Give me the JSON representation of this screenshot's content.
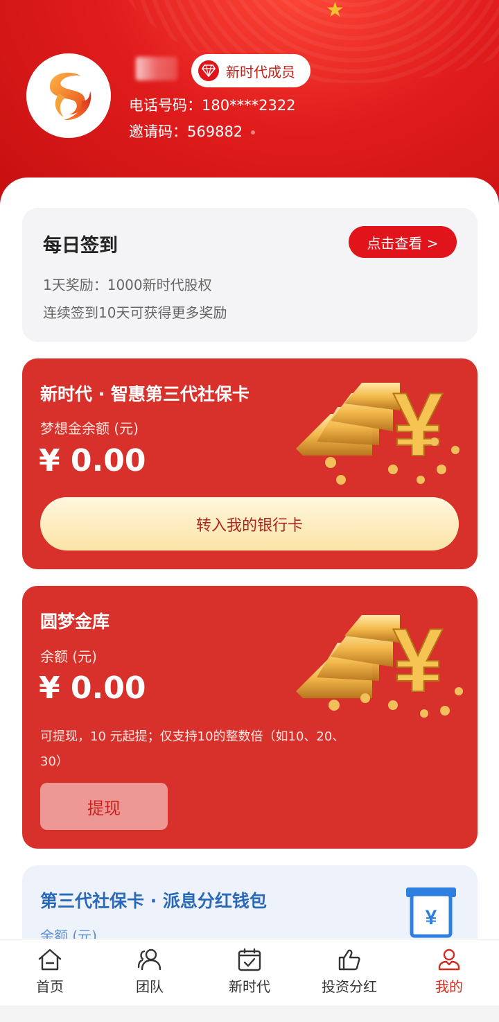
{
  "header": {
    "badge_label": "新时代成员",
    "phone": "电话号码：180****2322",
    "invite": "邀请码：569882"
  },
  "checkin": {
    "title": "每日签到",
    "button": "点击查看 >",
    "line1": "1天奖励：1000新时代股权",
    "line2": "连续签到10天可获得更多奖励"
  },
  "card1": {
    "title": "新时代 · 智惠第三代社保卡",
    "sub": "梦想金余额 (元)",
    "balance": "¥ 0.00",
    "button": "转入我的银行卡"
  },
  "card2": {
    "title": "圆梦金库",
    "sub": "余额 (元)",
    "balance": "¥ 0.00",
    "note": "可提现，10 元起提；仅支持10的整数倍（如10、20、30）",
    "button": "提现"
  },
  "card3": {
    "title": "第三代社保卡 · 派息分红钱包",
    "sub": "余额 (元)"
  },
  "tabs": [
    {
      "label": "首页",
      "icon": "home-icon"
    },
    {
      "label": "团队",
      "icon": "team-icon"
    },
    {
      "label": "新时代",
      "icon": "calendar-check-icon"
    },
    {
      "label": "投资分红",
      "icon": "thumbs-up-icon"
    },
    {
      "label": "我的",
      "icon": "user-icon",
      "active": true
    }
  ],
  "colors": {
    "primary_red": "#e0141a",
    "card_red": "#d8302a",
    "gold": "#f5c46a",
    "blue": "#2a69b8"
  }
}
